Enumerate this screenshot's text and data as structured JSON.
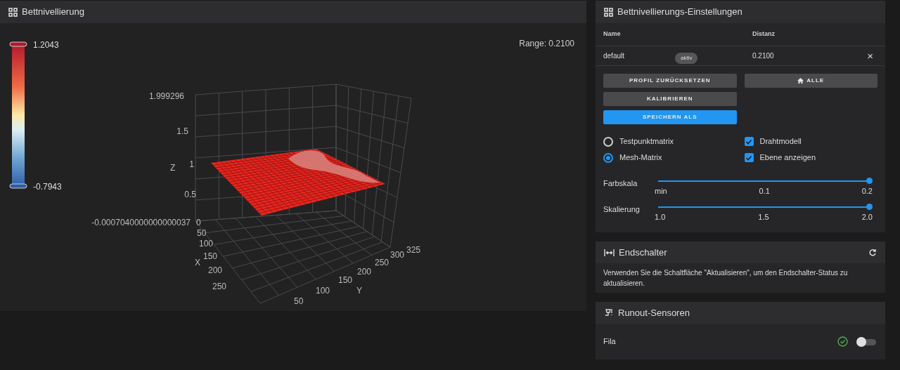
{
  "mesh_panel": {
    "title": "Bettnivellierung",
    "range": "Range: 0.2100",
    "colorbar": {
      "max": "1.2043",
      "min": "-0.7943"
    },
    "plot": {
      "z_label": "Z",
      "x_label": "X",
      "y_label": "Y",
      "z_ticks": [
        "1.999296",
        "1.5",
        "1",
        "0.5",
        "-0.0007040000000000037"
      ],
      "x_ticks": [
        "0",
        "50",
        "100",
        "150",
        "200",
        "250"
      ],
      "y_ticks": [
        "50",
        "100",
        "150",
        "200",
        "250",
        "300",
        "325"
      ]
    }
  },
  "settings_panel": {
    "title": "Bettnivellierungs-Einstellungen",
    "columns": [
      "Name",
      "Distanz"
    ],
    "profiles": [
      {
        "name": "default",
        "badge": "aktiv",
        "distance": "0.2100",
        "remove": "×"
      }
    ],
    "buttons": [
      {
        "label": "PROFIL ZURÜCKSETZEN",
        "kind": "plain"
      },
      {
        "label": "ALLE",
        "kind": "home"
      },
      {
        "label": "KALIBRIEREN",
        "kind": "plain"
      },
      {
        "label": "SPEICHERN ALS",
        "kind": "primary"
      }
    ],
    "radios": [
      {
        "label": "Testpunktmatrix",
        "selected": false
      },
      {
        "label": "Mesh-Matrix",
        "selected": true
      }
    ],
    "checkboxes": [
      {
        "label": "Drahtmodell",
        "checked": true
      },
      {
        "label": "Ebene anzeigen",
        "checked": true
      }
    ],
    "sliders": [
      {
        "label": "Farbskala",
        "level": 1,
        "ticks": [
          "min",
          "0.1",
          "0.2"
        ]
      },
      {
        "label": "Skalierung",
        "level": 1,
        "ticks": [
          "1.0",
          "1.5",
          "2.0"
        ]
      }
    ]
  },
  "endstop_panel": {
    "title": "Endschalter",
    "message": "Verwenden Sie die Schaltfläche \"Aktualisieren\", um den Endschalter-Status zu aktualisieren."
  },
  "runout_panel": {
    "title": "Runout-Sensoren",
    "sensors": [
      {
        "name": "Fila",
        "ok": true,
        "on": false
      }
    ]
  }
}
